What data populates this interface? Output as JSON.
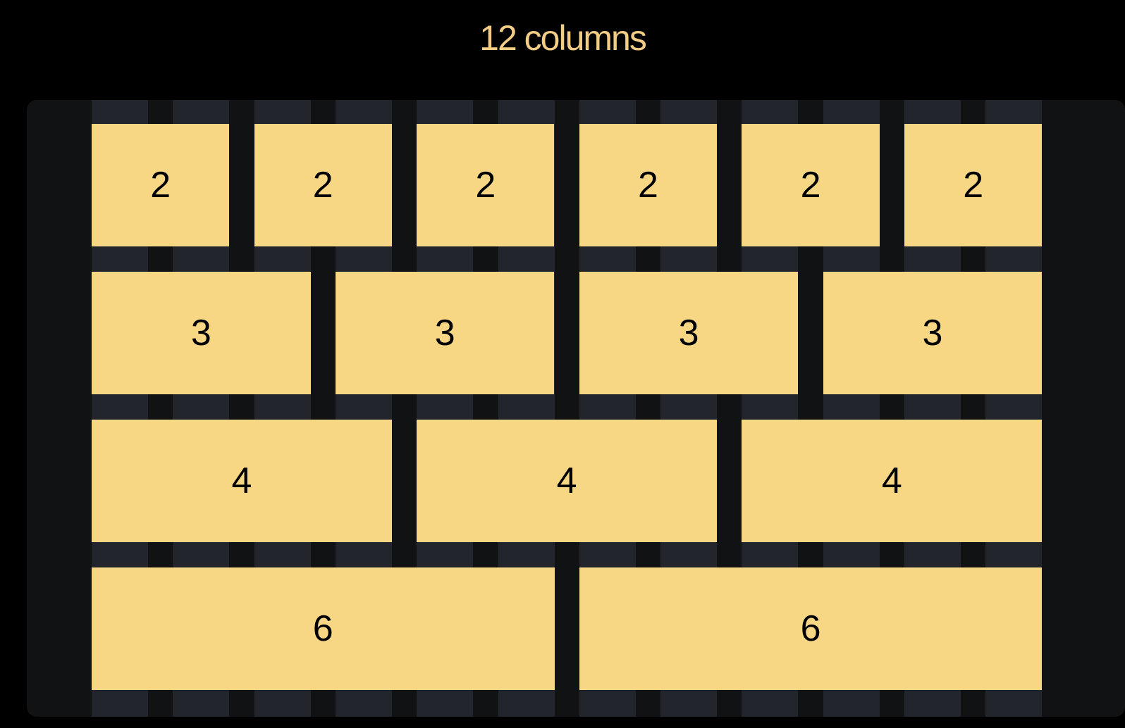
{
  "title": "12 columns",
  "colors": {
    "page_background": "#000000",
    "board_background": "#111214",
    "column_background": "#22252b",
    "cell_background": "#f7d684",
    "cell_text": "#000000",
    "title_text": "#f3cd85"
  },
  "grid": {
    "column_count": 12,
    "rows": [
      {
        "span": 2,
        "cells": [
          "2",
          "2",
          "2",
          "2",
          "2",
          "2"
        ]
      },
      {
        "span": 3,
        "cells": [
          "3",
          "3",
          "3",
          "3"
        ]
      },
      {
        "span": 4,
        "cells": [
          "4",
          "4",
          "4"
        ]
      },
      {
        "span": 6,
        "cells": [
          "6",
          "6"
        ]
      }
    ]
  }
}
